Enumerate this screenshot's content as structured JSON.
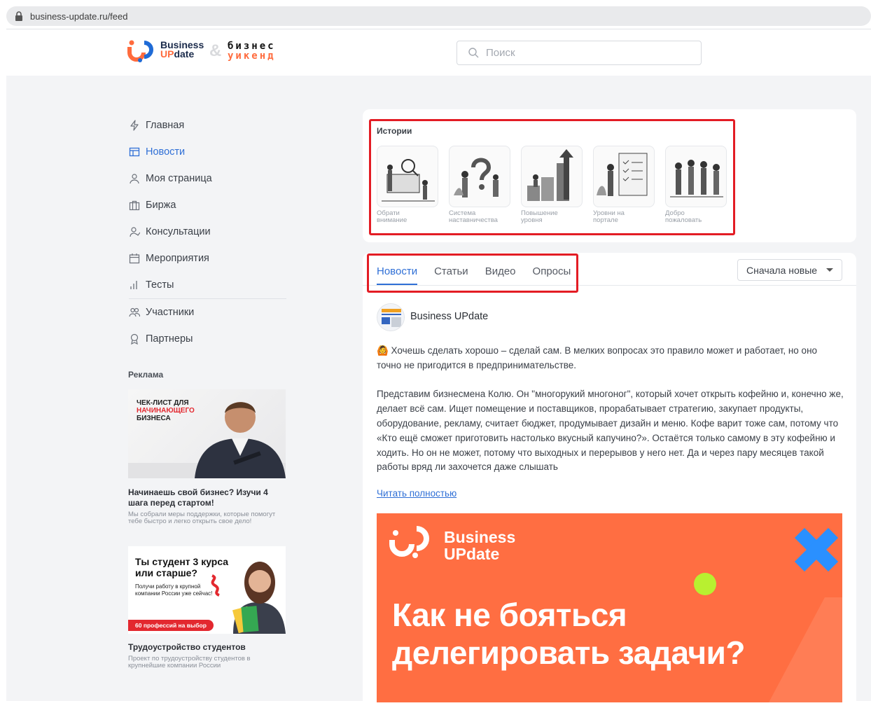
{
  "browser": {
    "url": "business-update.ru/feed"
  },
  "header": {
    "logo": {
      "line1": "Business",
      "line2_accent": "UP",
      "line2_rest": "date",
      "amp": "&",
      "bw_line1": "бизнес",
      "bw_line2": "уикенд"
    },
    "search_placeholder": "Поиск"
  },
  "nav": {
    "items": [
      {
        "label": "Главная",
        "icon": "lightning-icon",
        "active": false
      },
      {
        "label": "Новости",
        "icon": "layout-icon",
        "active": true
      },
      {
        "label": "Моя страница",
        "icon": "user-icon",
        "active": false
      },
      {
        "label": "Биржа",
        "icon": "briefcase-icon",
        "active": false
      },
      {
        "label": "Консультации",
        "icon": "person-icon",
        "active": false
      },
      {
        "label": "Мероприятия",
        "icon": "calendar-icon",
        "active": false
      },
      {
        "label": "Тесты",
        "icon": "bar-chart-icon",
        "active": false
      },
      {
        "label": "Участники",
        "icon": "users-icon",
        "active": false
      },
      {
        "label": "Партнеры",
        "icon": "award-icon",
        "active": false
      }
    ]
  },
  "ads": {
    "title": "Реклама",
    "ad1": {
      "tag_line1": "ЧЕК-ЛИСТ ДЛЯ",
      "tag_line2": "НАЧИНАЮЩЕГО",
      "tag_line3": "БИЗНЕСА",
      "heading": "Начинаешь свой бизнес? Изучи 4 шага перед стартом!",
      "text": "Мы собрали меры поддержки, которые помогут тебе быстро и легко открыть свое дело!"
    },
    "ad2": {
      "title_line1": "Ты студент 3 курса",
      "title_line2": "или старше?",
      "sub": "Получи работу в крупной компании России уже сейчас!",
      "pill": "60 профессий на выбор",
      "heading": "Трудоустройство студентов",
      "text": "Проект по трудоустройству студентов в крупнейшие компании России"
    }
  },
  "stories": {
    "title": "Истории",
    "items": [
      {
        "line1": "Обрати",
        "line2": "внимание"
      },
      {
        "line1": "Система",
        "line2": "наставничества"
      },
      {
        "line1": "Повышение",
        "line2": "уровня"
      },
      {
        "line1": "Уровни на",
        "line2": "портале"
      },
      {
        "line1": "Добро",
        "line2": "пожаловать"
      }
    ]
  },
  "feed": {
    "tabs": [
      {
        "label": "Новости",
        "active": true
      },
      {
        "label": "Статьи",
        "active": false
      },
      {
        "label": "Видео",
        "active": false
      },
      {
        "label": "Опросы",
        "active": false
      }
    ],
    "sort_label": "Сначала новые",
    "post": {
      "author": "Business UPdate",
      "avatar_text": "SMART TALK",
      "para1": "🙆 Хочешь сделать хорошо – сделай сам. В мелких вопросах это правило может и работает, но оно точно не пригодится в предпринимательстве.",
      "para2": "Представим бизнесмена Колю. Он \"многорукий многоног\", который хочет открыть кофейню и, конечно же, делает всё сам. Ищет помещение и поставщиков, прорабатывает стратегию, закупает продукты, оборудование, рекламу, считает бюджет, продумывает дизайн и меню. Кофе варит тоже сам, потому что «Кто ещё сможет приготовить настолько вкусный капучино?». Остаётся только самому в эту кофейню и ходить. Но он не может, потому что выходных и перерывов у него нет. Да и через пару месяцев такой работы вряд ли захочется даже слышать",
      "read_more": "Читать полностью",
      "banner": {
        "brand_line1": "Business",
        "brand_line2": "UPdate",
        "headline_line1": "Как не бояться",
        "headline_line2": "делегировать задачи?"
      }
    }
  },
  "colors": {
    "accent": "#2f6fd6",
    "brand_orange": "#ff6e42",
    "highlight_red": "#e31c24",
    "page_bg": "#f3f4f6"
  }
}
